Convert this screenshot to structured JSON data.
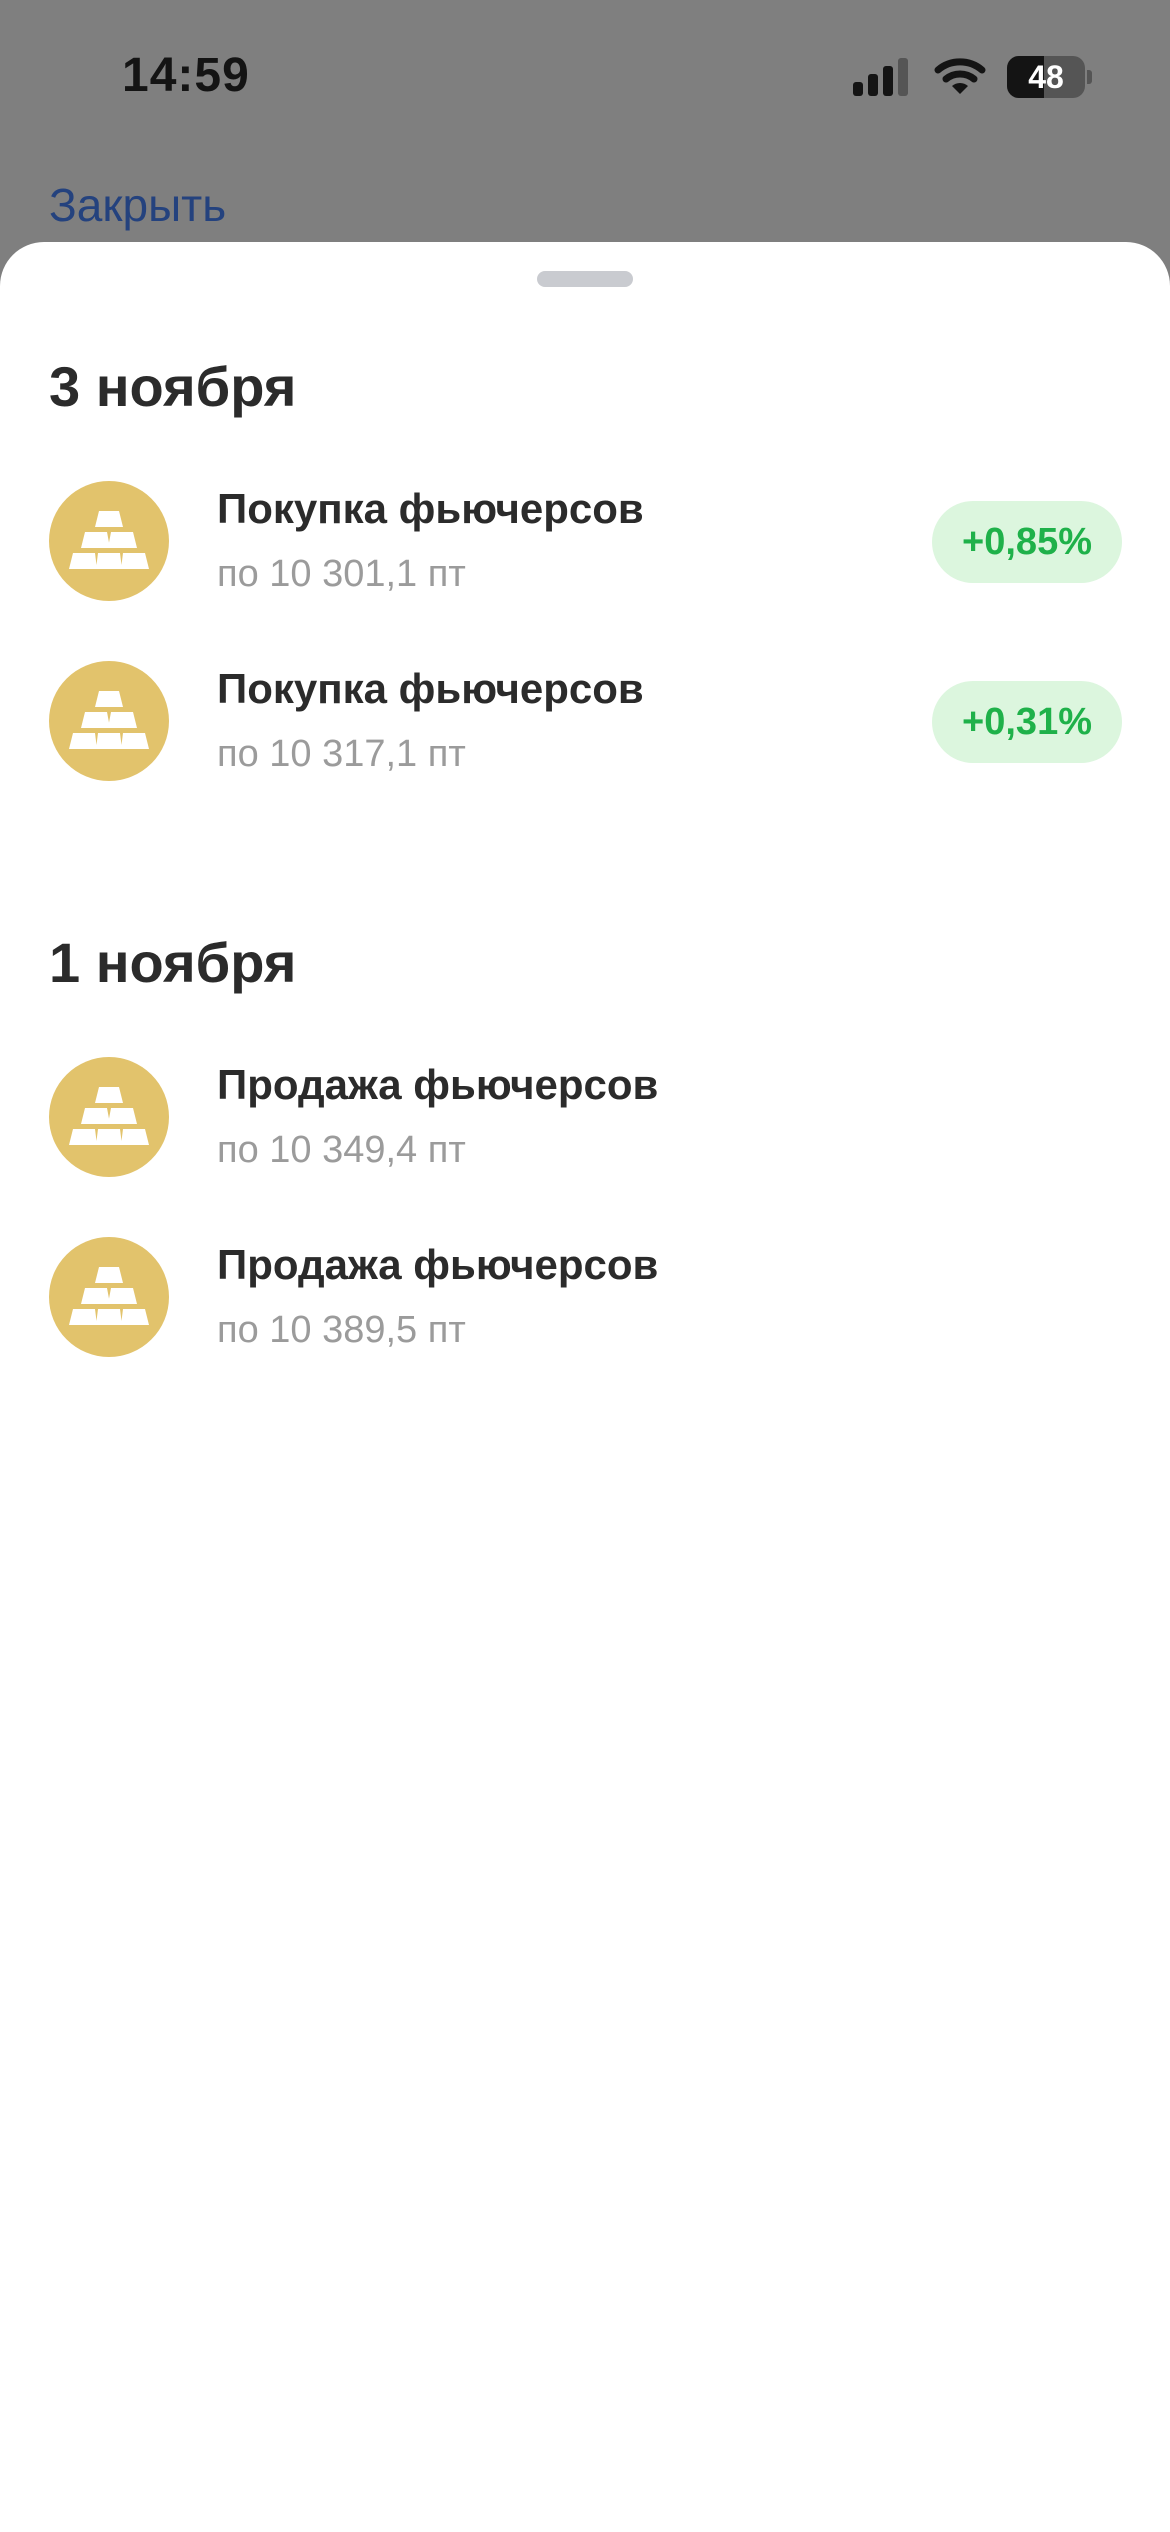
{
  "status_bar": {
    "time": "14:59",
    "battery_level": "48",
    "battery_fraction": 0.48,
    "icons": [
      "cellular-signal-icon",
      "wifi-icon",
      "battery-icon"
    ]
  },
  "header": {
    "close_label": "Закрыть"
  },
  "colors": {
    "accent_link": "#24427e",
    "icon_gold": "#e2c36c",
    "badge_bg": "#dcf6de",
    "badge_text": "#1fb14a",
    "title_text": "#2b2b2b",
    "secondary_text": "#9b9b9b"
  },
  "sections": [
    {
      "date": "3 ноября",
      "items": [
        {
          "icon": "gold-bars-icon",
          "title": "Покупка фьючерсов",
          "subtitle": "по 10 301,1 пт",
          "badge": "+0,85%"
        },
        {
          "icon": "gold-bars-icon",
          "title": "Покупка фьючерсов",
          "subtitle": "по 10 317,1 пт",
          "badge": "+0,31%"
        }
      ]
    },
    {
      "date": "1 ноября",
      "items": [
        {
          "icon": "gold-bars-icon",
          "title": "Продажа фьючерсов",
          "subtitle": "по 10 349,4 пт"
        },
        {
          "icon": "gold-bars-icon",
          "title": "Продажа фьючерсов",
          "subtitle": "по 10 389,5 пт"
        }
      ]
    }
  ]
}
